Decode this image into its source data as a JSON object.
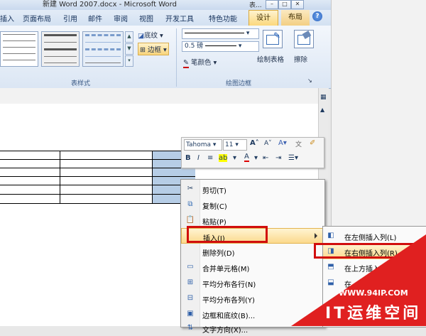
{
  "window": {
    "title": "新建 Word 2007.docx - Microsoft Word",
    "title_extra": "表..."
  },
  "tabs": [
    "插入",
    "页面布局",
    "引用",
    "邮件",
    "审阅",
    "视图",
    "开发工具",
    "特色功能",
    "设计",
    "布局"
  ],
  "active_tab": "设计",
  "ribbon": {
    "shading_label": "底纹",
    "borders_label": "边框",
    "line_weight": "0.5 磅",
    "pen_color_label": "笔颜色",
    "draw_table_label": "绘制表格",
    "eraser_label": "擦除",
    "group_table_styles": "表样式",
    "group_draw_borders": "绘图边框"
  },
  "mini_toolbar": {
    "font": "Tahoma",
    "size": "11"
  },
  "context_menu": {
    "items": [
      {
        "label": "剪切(T)",
        "icon": "scissors-icon"
      },
      {
        "label": "复制(C)",
        "icon": "copy-icon"
      },
      {
        "label": "粘贴(P)",
        "icon": "paste-icon"
      },
      {
        "label": "插入(I)",
        "icon": "",
        "submenu": true
      },
      {
        "label": "删除列(D)",
        "icon": ""
      },
      {
        "label": "合并单元格(M)",
        "icon": "merge-cells-icon"
      },
      {
        "label": "平均分布各行(N)",
        "icon": "distribute-rows-icon"
      },
      {
        "label": "平均分布各列(Y)",
        "icon": "distribute-columns-icon"
      },
      {
        "label": "边框和底纹(B)...",
        "icon": "borders-shading-icon"
      },
      {
        "label": "文字方向(X)...",
        "icon": "text-direction-icon"
      }
    ]
  },
  "insert_submenu": {
    "items": [
      {
        "label": "在左侧插入列(L)",
        "icon": "insert-column-left-icon"
      },
      {
        "label": "在右侧插入列(R)",
        "icon": "insert-column-right-icon"
      },
      {
        "label": "在上方插入",
        "icon": "insert-row-above-icon"
      },
      {
        "label": "在",
        "icon": "insert-row-below-icon"
      }
    ]
  },
  "watermark": {
    "url": "WWW.94IP.COM",
    "text": "IT运维空间",
    "color": "#e02020"
  },
  "colors": {
    "highlight": "#fbd98c",
    "annotation_red": "#d10d0d",
    "selected_cell": "#b6cde6"
  }
}
